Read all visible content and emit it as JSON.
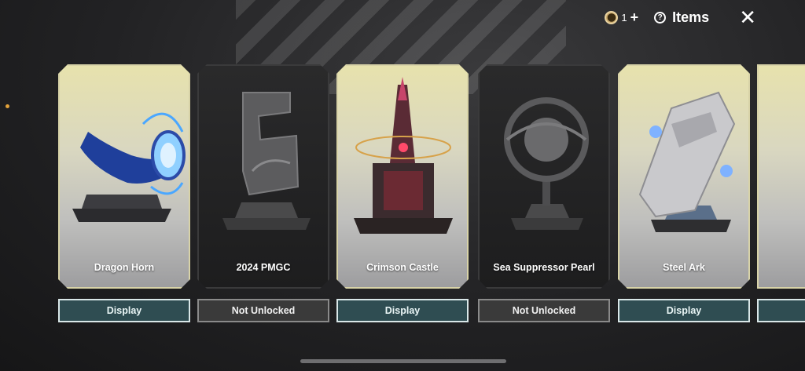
{
  "header": {
    "token_count": "1",
    "token_plus": "+",
    "title": "Items",
    "close_glyph": "✕"
  },
  "items": [
    {
      "name": "Dragon Horn",
      "button": "Display",
      "state": "unlocked"
    },
    {
      "name": "2024 PMGC",
      "button": "Not Unlocked",
      "state": "locked"
    },
    {
      "name": "Crimson Castle",
      "button": "Display",
      "state": "unlocked"
    },
    {
      "name": "Sea Suppressor Pearl",
      "button": "Not Unlocked",
      "state": "locked"
    },
    {
      "name": "Steel Ark",
      "button": "Display",
      "state": "unlocked"
    }
  ],
  "colors": {
    "accent_dot": "#e2a23b",
    "display_button": "#2f4d52",
    "locked_button": "#3a3a3a"
  }
}
